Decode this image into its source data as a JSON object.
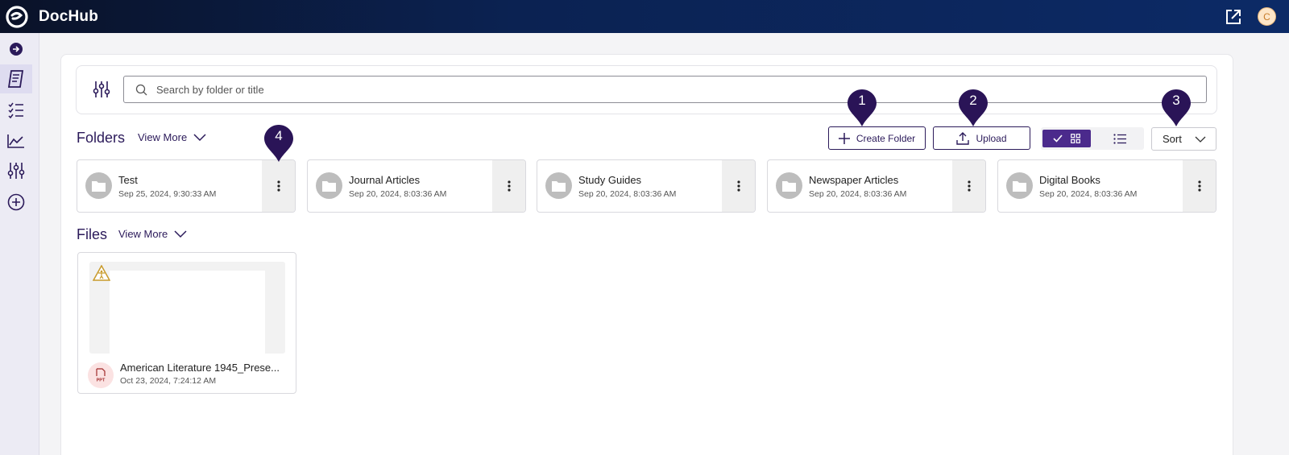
{
  "app": {
    "brand": "DocHub",
    "avatar_initial": "C"
  },
  "sidebar": {
    "items": [
      {
        "name": "expand-icon"
      },
      {
        "name": "documents-icon",
        "active": true
      },
      {
        "name": "checklist-icon"
      },
      {
        "name": "analytics-icon"
      },
      {
        "name": "settings-sliders-icon"
      },
      {
        "name": "add-icon"
      }
    ]
  },
  "search": {
    "placeholder": "Search by folder or title",
    "value": ""
  },
  "folders": {
    "title": "Folders",
    "view_more": "View More",
    "items": [
      {
        "name": "Test",
        "date": "Sep 25, 2024, 9:30:33 AM"
      },
      {
        "name": "Journal Articles",
        "date": "Sep 20, 2024, 8:03:36 AM"
      },
      {
        "name": "Study Guides",
        "date": "Sep 20, 2024, 8:03:36 AM"
      },
      {
        "name": "Newspaper Articles",
        "date": "Sep 20, 2024, 8:03:36 AM"
      },
      {
        "name": "Digital Books",
        "date": "Sep 20, 2024, 8:03:36 AM"
      }
    ]
  },
  "toolbar": {
    "create_folder": "Create Folder",
    "upload": "Upload",
    "sort": "Sort"
  },
  "files": {
    "title": "Files",
    "view_more": "View More",
    "items": [
      {
        "name": "American Literature 1945_Prese...",
        "date": "Oct 23, 2024, 7:24:12 AM",
        "type": "PPT"
      }
    ]
  },
  "markers": [
    "1",
    "2",
    "3",
    "4"
  ],
  "colors": {
    "accent": "#2b1a5a",
    "marker": "#2a1457",
    "toggle_active": "#4b2a8c"
  }
}
